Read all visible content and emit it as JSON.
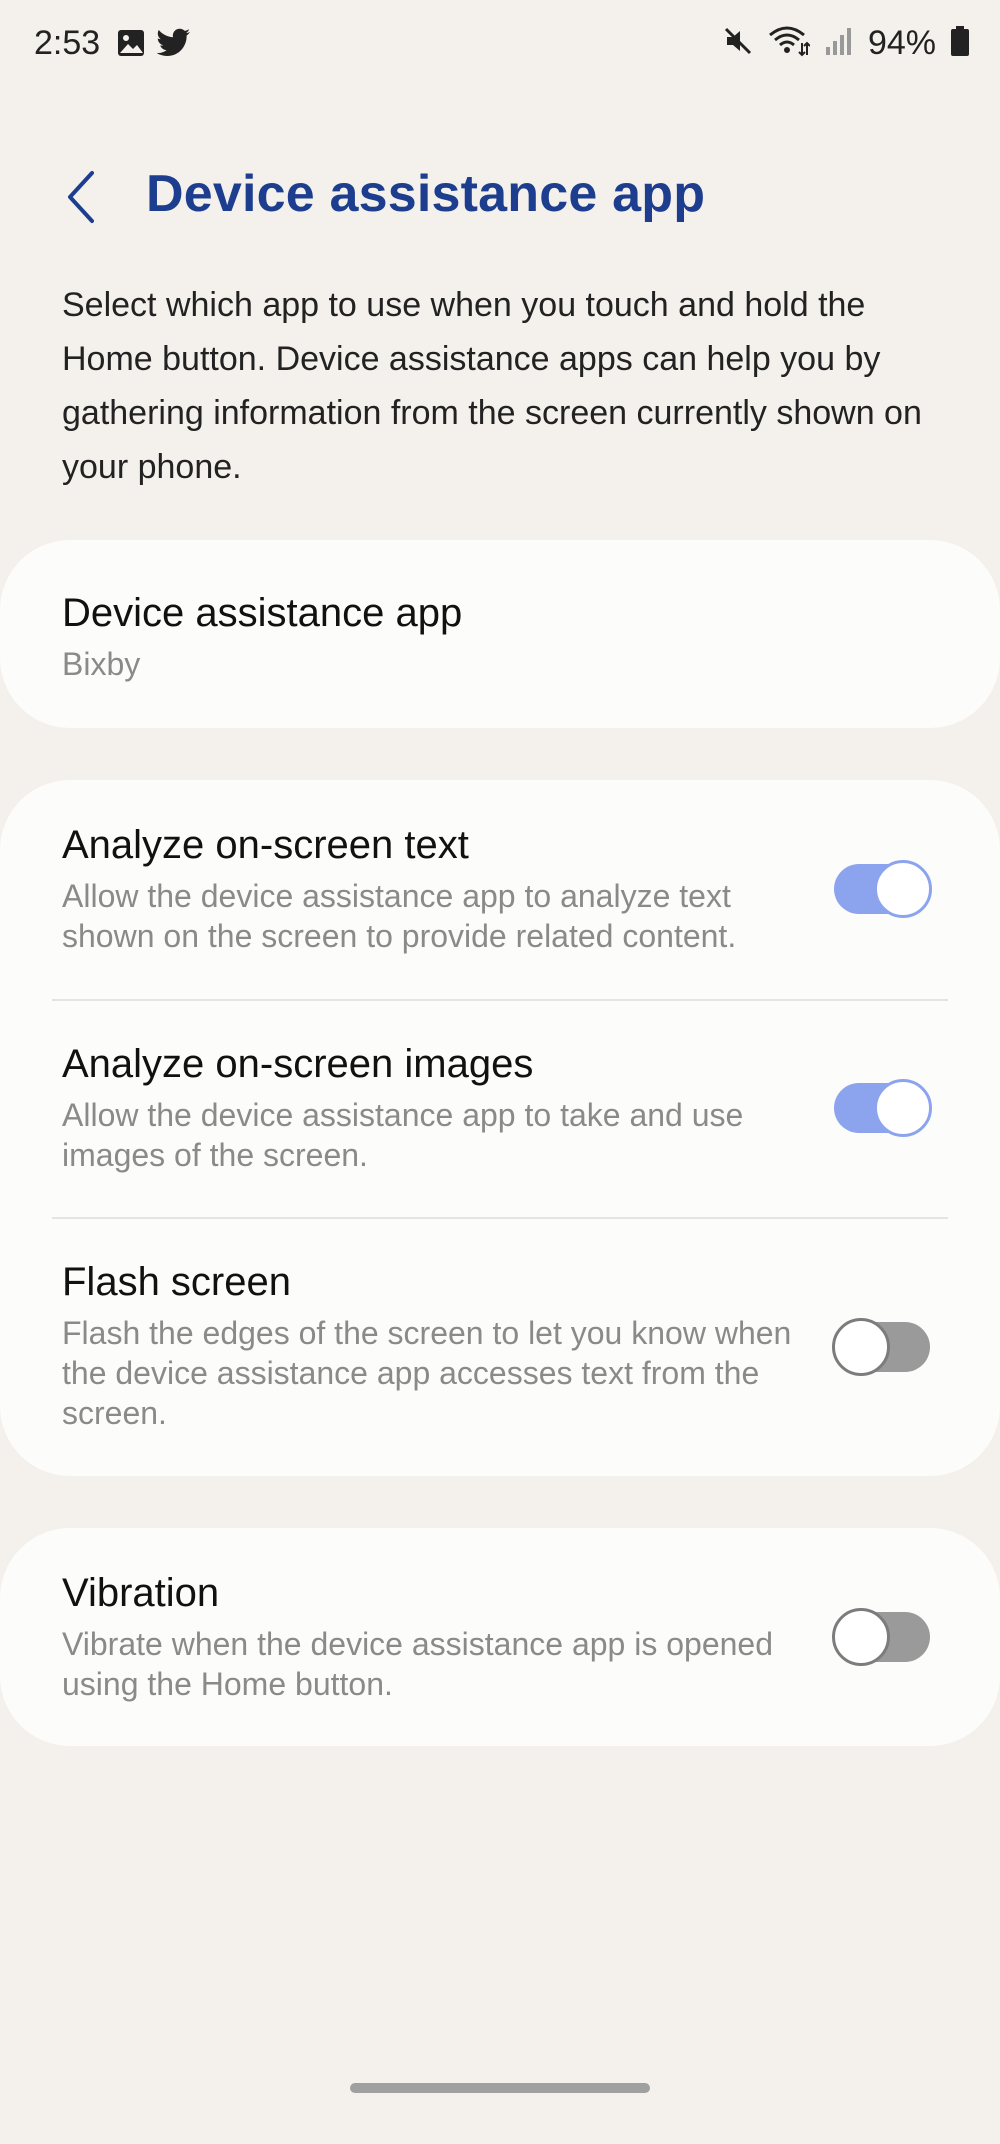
{
  "status_bar": {
    "time": "2:53",
    "battery": "94%",
    "icons": [
      "image-icon",
      "twitter-icon",
      "mute-icon",
      "wifi-icon",
      "signal-icon",
      "battery-icon"
    ]
  },
  "header": {
    "title": "Device assistance app",
    "back_icon": "back-arrow-icon"
  },
  "description": "Select which app to use when you touch and hold the Home button. Device assistance apps can help you by gathering information from the screen currently shown on your phone.",
  "app_setting": {
    "title": "Device assistance app",
    "value": "Bixby"
  },
  "settings": [
    {
      "title": "Analyze on-screen text",
      "subtitle": "Allow the device assistance app to analyze text shown on the screen to provide related content.",
      "enabled": true
    },
    {
      "title": "Analyze on-screen images",
      "subtitle": "Allow the device assistance app to take and use images of the screen.",
      "enabled": true
    },
    {
      "title": "Flash screen",
      "subtitle": "Flash the edges of the screen to let you know when the device assistance app accesses text from the screen.",
      "enabled": false
    }
  ],
  "vibration": {
    "title": "Vibration",
    "subtitle": "Vibrate when the device assistance app is opened using the Home button.",
    "enabled": false
  },
  "colors": {
    "title": "#1d3e8f",
    "toggle_on": "#8ca4ee",
    "toggle_off": "#9a9a9a",
    "background": "#f4f1ec",
    "card": "#fcfcfb"
  }
}
